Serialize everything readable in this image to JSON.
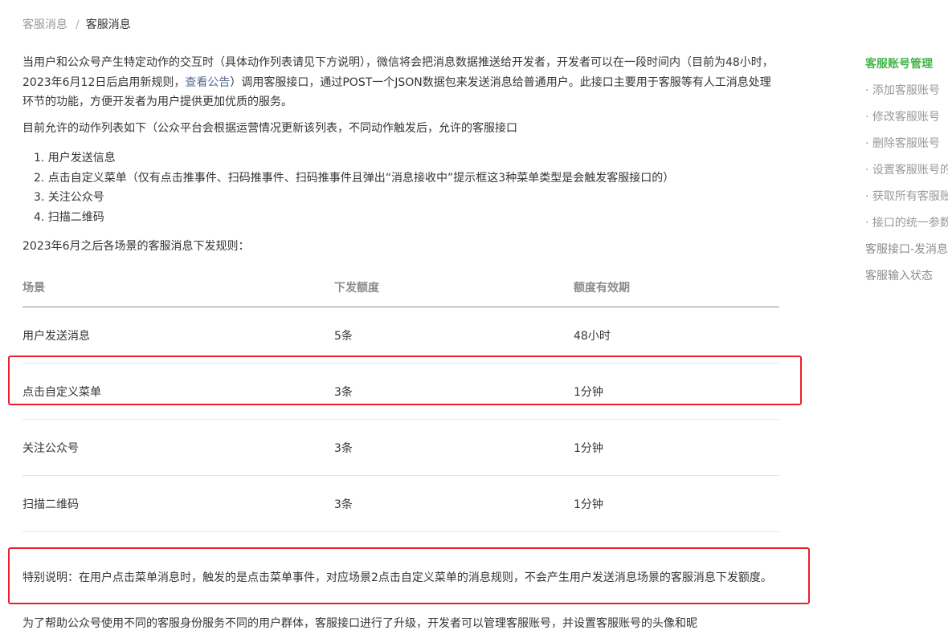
{
  "breadcrumb": {
    "parent": "客服消息",
    "separator": "/",
    "current": "客服消息"
  },
  "intro": {
    "text_before_link": "当用户和公众号产生特定动作的交互时（具体动作列表请见下方说明），微信将会把消息数据推送给开发者，开发者可以在一段时间内（目前为48小时，2023年6月12日后启用新规则，",
    "link": "查看公告",
    "text_after_link": "）调用客服接口，通过POST一个JSON数据包来发送消息给普通用户。此接口主要用于客服等有人工消息处理环节的功能，方便开发者为用户提供更加优质的服务。"
  },
  "actions_intro": "目前允许的动作列表如下（公众平台会根据运营情况更新该列表，不同动作触发后，允许的客服接口",
  "actions": [
    "1. 用户发送信息",
    "2. 点击自定义菜单（仅有点击推事件、扫码推事件、扫码推事件且弹出“消息接收中”提示框这3种菜单类型是会触发客服接口的）",
    "3. 关注公众号",
    "4. 扫描二维码"
  ],
  "rules_intro": "2023年6月之后各场景的客服消息下发规则：",
  "table": {
    "headers": [
      "场景",
      "下发额度",
      "额度有效期"
    ],
    "rows": [
      [
        "用户发送消息",
        "5条",
        "48小时"
      ],
      [
        "点击自定义菜单",
        "3条",
        "1分钟"
      ],
      [
        "关注公众号",
        "3条",
        "1分钟"
      ],
      [
        "扫描二维码",
        "3条",
        "1分钟"
      ]
    ]
  },
  "special_note": "特别说明：在用户点击菜单消息时，触发的是点击菜单事件，对应场景2点击自定义菜单的消息规则，不会产生用户发送消息场景的客服消息下发额度。",
  "cut_text": "为了帮助公众号使用不同的客服身份服务不同的用户群体，客服接口进行了升级，开发者可以管理客服账号，并设置客服账号的头像和昵",
  "sidebar": {
    "items": [
      "客服账号管理",
      "· 添加客服账号",
      "· 修改客服账号",
      "· 删除客服账号",
      "· 设置客服账号的头像",
      "· 获取所有客服账号",
      "· 接口的统一参数说明",
      "客服接口-发消息",
      "客服输入状态"
    ]
  },
  "colors": {
    "accent_green": "#44b549",
    "link_blue": "#576b95",
    "highlight_red": "#e8212b"
  }
}
